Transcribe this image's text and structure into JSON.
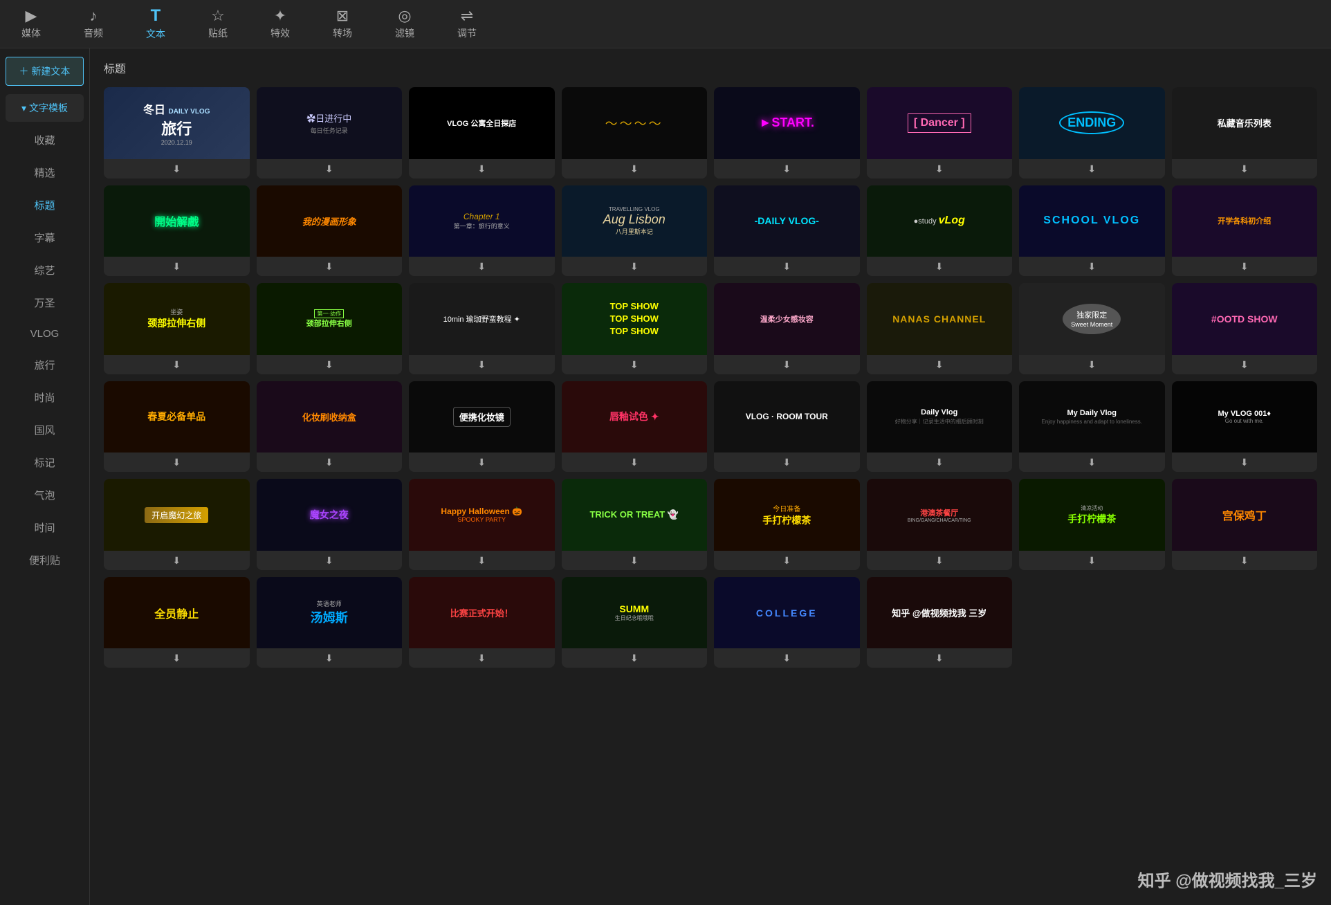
{
  "toolbar": {
    "items": [
      {
        "label": "媒体",
        "icon": "▶",
        "active": false
      },
      {
        "label": "音频",
        "icon": "♪",
        "active": false
      },
      {
        "label": "文本",
        "icon": "T",
        "active": true
      },
      {
        "label": "贴纸",
        "icon": "☆",
        "active": false
      },
      {
        "label": "特效",
        "icon": "✦",
        "active": false
      },
      {
        "label": "转场",
        "icon": "⊠",
        "active": false
      },
      {
        "label": "滤镜",
        "icon": "◎",
        "active": false
      },
      {
        "label": "调节",
        "icon": "⇌",
        "active": false
      }
    ]
  },
  "sidebar": {
    "new_text_label": "＋ 新建文本",
    "template_label": "▾ 文字模板",
    "categories": [
      {
        "label": "收藏",
        "active": false
      },
      {
        "label": "精选",
        "active": false
      },
      {
        "label": "标题",
        "active": true
      },
      {
        "label": "字幕",
        "active": false
      },
      {
        "label": "综艺",
        "active": false
      },
      {
        "label": "万圣",
        "active": false
      },
      {
        "label": "VLOG",
        "active": false
      },
      {
        "label": "旅行",
        "active": false
      },
      {
        "label": "时尚",
        "active": false
      },
      {
        "label": "国风",
        "active": false
      },
      {
        "label": "标记",
        "active": false
      },
      {
        "label": "气泡",
        "active": false
      },
      {
        "label": "时间",
        "active": false
      },
      {
        "label": "便利贴",
        "active": false
      }
    ]
  },
  "content": {
    "title": "标题",
    "download_icon": "⬇"
  },
  "cards": [
    {
      "id": 1,
      "bg": "#1a2a4a",
      "text": "冬日旅行",
      "sub": "DAILY VLOG 2020.12.19",
      "color": "#ffffff",
      "style": "winter"
    },
    {
      "id": 2,
      "bg": "#1a1a2e",
      "text": "※日进行中",
      "color": "#ccccff",
      "style": "starry"
    },
    {
      "id": 3,
      "bg": "#000000",
      "text": "VLOG 公寓全日探店",
      "color": "#ffffff",
      "style": "dark_vlog"
    },
    {
      "id": 4,
      "bg": "#111111",
      "text": "～～～",
      "color": "#d4a000",
      "style": "wave"
    },
    {
      "id": 5,
      "bg": "#0a0a1a",
      "text": "►START.",
      "color": "#ff00ff",
      "style": "start"
    },
    {
      "id": 6,
      "bg": "#1a0a2a",
      "text": "[ Dancer ]",
      "color": "#ff69b4",
      "style": "dancer"
    },
    {
      "id": 7,
      "bg": "#0a1a2a",
      "text": "ENDING",
      "color": "#00bfff",
      "style": "ending"
    },
    {
      "id": 8,
      "bg": "#1a1a1a",
      "text": "私藏音乐列表",
      "color": "#ffffff",
      "style": "music"
    },
    {
      "id": 9,
      "bg": "#0a1a0a",
      "text": "開始解戲",
      "color": "#00ff88",
      "style": "game_start"
    },
    {
      "id": 10,
      "bg": "#1a0a00",
      "text": "我的漫画形象",
      "color": "#ff8800",
      "style": "comic"
    },
    {
      "id": 11,
      "bg": "#0a0a2a",
      "text": "Chapter 1 第一章：旅行的意义",
      "color": "#d4a000",
      "style": "chapter"
    },
    {
      "id": 12,
      "bg": "#0a1a2a",
      "text": "TRAVELLING VLOG Aug Lisbon 八月里斯本记",
      "color": "#e8d5a0",
      "style": "travel"
    },
    {
      "id": 13,
      "bg": "#0f0f1f",
      "text": "-DAILY VLOG-",
      "color": "#00e5ff",
      "style": "daily"
    },
    {
      "id": 14,
      "bg": "#0a1a0a",
      "text": "study vLog",
      "color": "#ffffff",
      "style": "study"
    },
    {
      "id": 15,
      "bg": "#0a0a2a",
      "text": "SCHOOL VLOG",
      "color": "#00bfff",
      "style": "school"
    },
    {
      "id": 16,
      "bg": "#1a0a2a",
      "text": "开学各科初介绍",
      "color": "#ff9900",
      "style": "school2"
    },
    {
      "id": 17,
      "bg": "#1a1a00",
      "text": "坐姿 颈部拉伸右侧",
      "color": "#ffff00",
      "style": "stretch"
    },
    {
      "id": 18,
      "bg": "#0a1a00",
      "text": "第一-幼作 颈部拉伸右侧",
      "color": "#88ff44",
      "style": "stretch2"
    },
    {
      "id": 19,
      "bg": "#1a1a1a",
      "text": "10min 瑜珈野蛮教程",
      "color": "#ffffff",
      "style": "yoga"
    },
    {
      "id": 20,
      "bg": "#0a2a0a",
      "text": "TOP SHOW TOP SHOW TOP SHOW",
      "color": "#ffff00",
      "style": "topshow"
    },
    {
      "id": 21,
      "bg": "#1a0a1a",
      "text": "温柔少女感妆容",
      "color": "#ffaacc",
      "style": "makeup"
    },
    {
      "id": 22,
      "bg": "#1a1a0a",
      "text": "NANAS CHANNEL",
      "color": "#d4a000",
      "style": "nanas"
    },
    {
      "id": 23,
      "bg": "#222222",
      "text": "独家限定 Sweet Moment",
      "color": "#dddddd",
      "style": "exclusive"
    },
    {
      "id": 24,
      "bg": "#1a0a2a",
      "text": "#OOTD SHOW",
      "color": "#ff69b4",
      "style": "ootd"
    },
    {
      "id": 25,
      "bg": "#1a0a00",
      "text": "春夏必备单品",
      "color": "#ffaa00",
      "style": "spring"
    },
    {
      "id": 26,
      "bg": "#1a0a1a",
      "text": "化妆刷收纳盒",
      "color": "#ff8800",
      "style": "brush"
    },
    {
      "id": 27,
      "bg": "#0a0a0a",
      "text": "便携化妆镜",
      "color": "#ffffff",
      "style": "mirror"
    },
    {
      "id": 28,
      "bg": "#2a0a0a",
      "text": "唇釉试色",
      "color": "#ff3366",
      "style": "lipstick"
    },
    {
      "id": 29,
      "bg": "#111111",
      "text": "VLOG · ROOM TOUR",
      "color": "#ffffff",
      "style": "roomtour"
    },
    {
      "id": 30,
      "bg": "#0a0a0a",
      "text": "Daily Vlog 好物分享｜记录生活中的细后顾时刻",
      "color": "#aaaaaa",
      "style": "dailyvlog2"
    },
    {
      "id": 31,
      "bg": "#0a0a0a",
      "text": "My Daily Vlog Enjoy happiness and adapt to loneliness.",
      "color": "#ffffff",
      "style": "mydaily"
    },
    {
      "id": 32,
      "bg": "#050505",
      "text": "My VLOG 001♦ Go out with me.",
      "color": "#ffffff",
      "style": "myvlog001"
    },
    {
      "id": 33,
      "bg": "#1a1a00",
      "text": "开启魔幻之旅",
      "color": "#d4a000",
      "style": "magic"
    },
    {
      "id": 34,
      "bg": "#0a0a1a",
      "text": "魔女之夜",
      "color": "#aa44ff",
      "style": "witch"
    },
    {
      "id": 35,
      "bg": "#2a0a0a",
      "text": "Happy Halloween SPOOKY PARTY",
      "color": "#ff8800",
      "style": "halloween"
    },
    {
      "id": 36,
      "bg": "#0a2a0a",
      "text": "TRICK OR TREAT",
      "color": "#88ff44",
      "style": "trick"
    },
    {
      "id": 37,
      "bg": "#1a0a00",
      "text": "今日准备 手打柠檬茶",
      "color": "#ffaa00",
      "style": "lemon"
    },
    {
      "id": 38,
      "bg": "#1a0a0a",
      "text": "港澳茶餐厅 BING/GANG/CHA/CAR/TING",
      "color": "#ff4444",
      "style": "teashop"
    },
    {
      "id": 39,
      "bg": "#0a1a00",
      "text": "手打柠檬茶",
      "color": "#88ff00",
      "style": "lemon2"
    },
    {
      "id": 40,
      "bg": "#1a0a1a",
      "text": "宫保鸡丁",
      "color": "#ff8800",
      "style": "kungpao"
    },
    {
      "id": 41,
      "bg": "#1a0a00",
      "text": "全员静止",
      "color": "#ffdd00",
      "style": "freeze"
    },
    {
      "id": 42,
      "bg": "#0a0a1a",
      "text": "英语老师 汤姆斯",
      "color": "#00aaff",
      "style": "teacher"
    },
    {
      "id": 43,
      "bg": "#2a0a0a",
      "text": "比赛正式开始！",
      "color": "#ff4444",
      "style": "contest"
    },
    {
      "id": 44,
      "bg": "#0a1a0a",
      "text": "SUMM 生日纪念哦哦哦",
      "color": "#ffff00",
      "style": "summer"
    },
    {
      "id": 45,
      "bg": "#0a0a2a",
      "text": "COLLEGE",
      "color": "#4488ff",
      "style": "college"
    },
    {
      "id": 46,
      "bg": "#1a0a0a",
      "text": "知乎 @做视频找我 三岁",
      "color": "#ffffff",
      "style": "zhihu"
    }
  ],
  "watermark": "知乎 @做视频找我_三岁"
}
